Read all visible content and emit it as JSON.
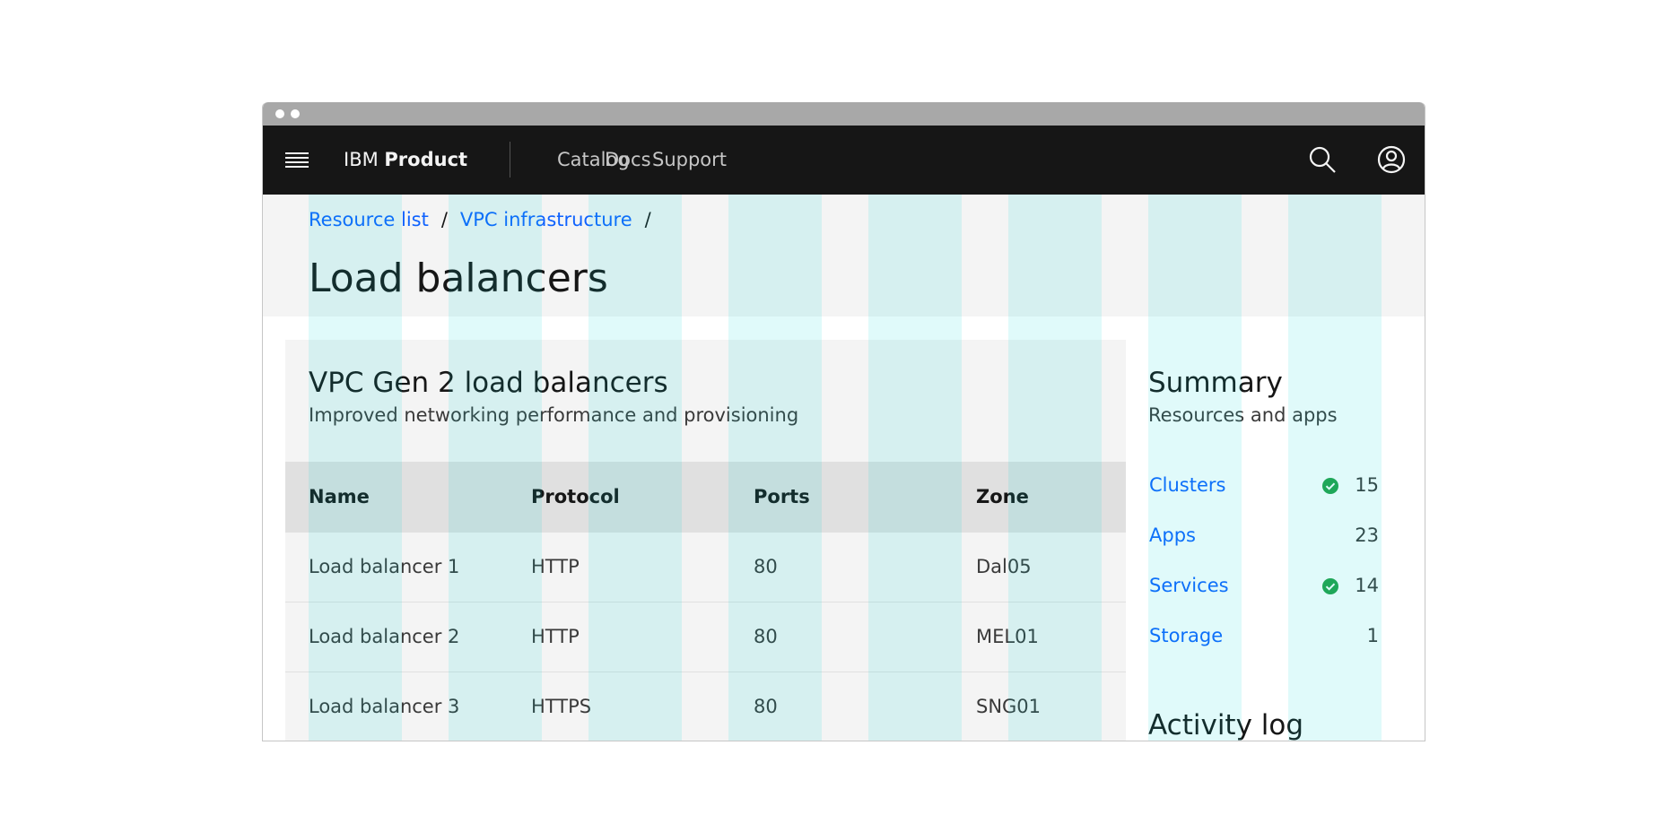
{
  "header": {
    "brand_prefix": "IBM",
    "brand_name": "Product",
    "nav": [
      "Catalog",
      "Docs",
      "Support"
    ]
  },
  "breadcrumb": {
    "items": [
      "Resource list",
      "VPC infrastructure"
    ],
    "separator": "/"
  },
  "page": {
    "title": "Load balancers"
  },
  "tile": {
    "title": "VPC Gen 2 load balancers",
    "subtitle": "Improved networking performance and provisioning"
  },
  "table": {
    "columns": [
      "Name",
      "Protocol",
      "Ports",
      "Zone"
    ],
    "rows": [
      [
        "Load balancer 1",
        "HTTP",
        "80",
        "Dal05"
      ],
      [
        "Load balancer 2",
        "HTTP",
        "80",
        "MEL01"
      ],
      [
        "Load balancer 3",
        "HTTPS",
        "80",
        "SNG01"
      ]
    ]
  },
  "summary": {
    "title": "Summary",
    "subtitle": "Resources and apps",
    "items": [
      {
        "label": "Clusters",
        "count": "15",
        "status_icon": "checkmark-filled-icon"
      },
      {
        "label": "Apps",
        "count": "23",
        "status_icon": ""
      },
      {
        "label": "Services",
        "count": "14",
        "status_icon": "checkmark-filled-icon"
      },
      {
        "label": "Storage",
        "count": "1",
        "status_icon": ""
      }
    ]
  },
  "activity": {
    "title": "Activity log"
  },
  "icons": {
    "menu": "hamburger-menu-icon",
    "search": "search-icon",
    "user": "user-avatar-icon"
  },
  "colors": {
    "shell": "#161616",
    "link": "#0f62fe",
    "success": "#24a148",
    "layer": "#f4f4f4",
    "table_header": "#e0e0e0",
    "grid_overlay": "#00d2d2"
  }
}
